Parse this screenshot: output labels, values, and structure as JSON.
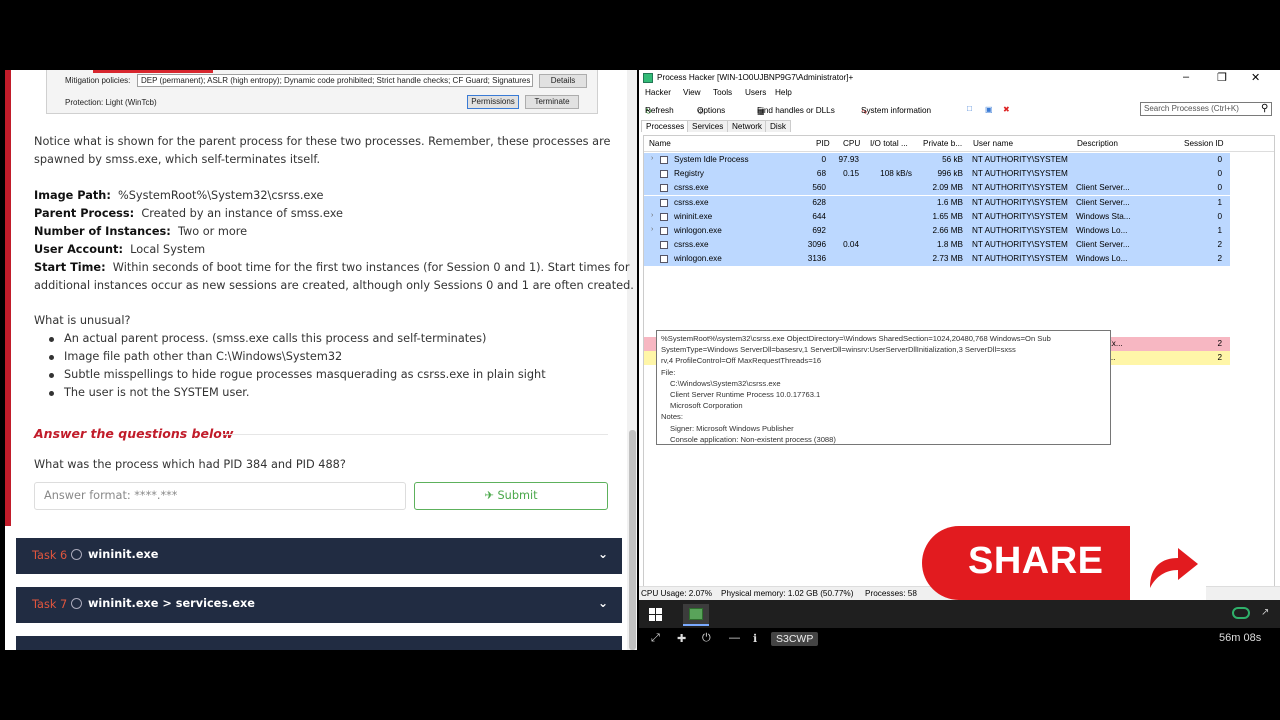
{
  "mini_screenshot": {
    "mitigation_label": "Mitigation policies:",
    "mitigation_value": "DEP (permanent); ASLR (high entropy); Dynamic code prohibited; Strict handle checks; CF Guard; Signatures re",
    "details_btn": "Details",
    "protection_label": "Protection:",
    "protection_value": "Light (WinTcb)",
    "permissions_btn": "Permissions",
    "terminate_btn": "Terminate"
  },
  "room": {
    "intro_line1": "Notice what is shown for the parent process for these two processes. Remember, these processes are",
    "intro_line2": "spawned by smss.exe, which self-terminates itself.",
    "image_path_label": "Image Path:",
    "image_path_value": "%SystemRoot%\\System32\\csrss.exe",
    "parent_label": "Parent Process:",
    "parent_value": "Created by an instance of smss.exe",
    "instances_label": "Number of Instances:",
    "instances_value": "Two or more",
    "account_label": "User Account:",
    "account_value": "Local System",
    "start_label": "Start Time:",
    "start_value1": "Within seconds of boot time for the first two instances (for Session 0 and 1). Start times for",
    "start_value2": "additional instances occur as new sessions are created, although only Sessions 0 and 1 are often created.",
    "unusual_title": "What is unusual?",
    "unusual_items": [
      "An actual parent process. (smss.exe calls this process and self-terminates)",
      "Image file path other than C:\\Windows\\System32",
      "Subtle misspellings to hide rogue processes masquerading as csrss.exe in plain sight",
      "The user is not the SYSTEM user."
    ],
    "answer_title": "Answer the questions below",
    "question": "What was the process which had PID 384 and PID 488?",
    "answer_placeholder": "Answer format: ****.***",
    "submit_label": "Submit"
  },
  "tasks": [
    {
      "num": "Task 6",
      "name": "wininit.exe"
    },
    {
      "num": "Task 7",
      "name": "wininit.exe > services.exe"
    }
  ],
  "process_hacker": {
    "title": "Process Hacker [WIN-1O0UJBNP9G7\\Administrator]+",
    "menu": [
      "Hacker",
      "View",
      "Tools",
      "Users",
      "Help"
    ],
    "toolbar": {
      "refresh": "Refresh",
      "options": "Options",
      "find": "Find handles or DLLs",
      "sysinfo": "System information"
    },
    "search_placeholder": "Search Processes (Ctrl+K)",
    "tabs": [
      "Processes",
      "Services",
      "Network",
      "Disk"
    ],
    "columns": [
      "Name",
      "PID",
      "CPU",
      "I/O total ...",
      "Private b...",
      "User name",
      "Description",
      "Session ID"
    ],
    "rows": [
      {
        "name": "System Idle Process",
        "pid": "0",
        "cpu": "97.93",
        "io": "",
        "priv": "56 kB",
        "user": "NT AUTHORITY\\SYSTEM",
        "desc": "",
        "session": "0"
      },
      {
        "name": "Registry",
        "pid": "68",
        "cpu": "0.15",
        "io": "108 kB/s",
        "priv": "996 kB",
        "user": "NT AUTHORITY\\SYSTEM",
        "desc": "",
        "session": "0"
      },
      {
        "name": "csrss.exe",
        "pid": "560",
        "cpu": "",
        "io": "",
        "priv": "2.09 MB",
        "user": "NT AUTHORITY\\SYSTEM",
        "desc": "Client Server...",
        "session": "0"
      },
      {
        "name": "csrss.exe",
        "pid": "628",
        "cpu": "",
        "io": "",
        "priv": "1.6 MB",
        "user": "NT AUTHORITY\\SYSTEM",
        "desc": "Client Server...",
        "session": "1"
      },
      {
        "name": "wininit.exe",
        "pid": "644",
        "cpu": "",
        "io": "",
        "priv": "1.65 MB",
        "user": "NT AUTHORITY\\SYSTEM",
        "desc": "Windows Sta...",
        "session": "0"
      },
      {
        "name": "winlogon.exe",
        "pid": "692",
        "cpu": "",
        "io": "",
        "priv": "2.66 MB",
        "user": "NT AUTHORITY\\SYSTEM",
        "desc": "Windows Lo...",
        "session": "1"
      },
      {
        "name": "csrss.exe",
        "pid": "3096",
        "cpu": "0.04",
        "io": "",
        "priv": "1.8 MB",
        "user": "NT AUTHORITY\\SYSTEM",
        "desc": "Client Server...",
        "session": "2"
      },
      {
        "name": "winlogon.exe",
        "pid": "3136",
        "cpu": "",
        "io": "",
        "priv": "2.73 MB",
        "user": "NT AUTHORITY\\SYSTEM",
        "desc": "Windows Lo...",
        "session": "2"
      }
    ],
    "partial_rows": [
      {
        "desc": "ws Ex...",
        "session": "2"
      },
      {
        "desc": "Hac...",
        "session": "2"
      }
    ],
    "tooltip": [
      "%SystemRoot%\\system32\\csrss.exe ObjectDirectory=\\Windows SharedSection=1024,20480,768 Windows=On Sub",
      "SystemType=Windows ServerDll=basesrv,1 ServerDll=winsrv:UserServerDllInitialization,3 ServerDll=sxss",
      "rv,4 ProfileControl=Off MaxRequestThreads=16",
      "File:",
      "C:\\Windows\\System32\\csrss.exe",
      "Client Server Runtime Process 10.0.17763.1",
      "Microsoft Corporation",
      "Notes:",
      "Signer: Microsoft Windows Publisher",
      "Console application: Non-existent process (3088)"
    ],
    "status": {
      "cpu": "CPU Usage: 2.07%",
      "mem": "Physical memory: 1.02 GB (50.77%)",
      "procs": "Processes: 58"
    }
  },
  "guac": {
    "tag": "S3CWP",
    "timer": "56m 08s"
  },
  "share": {
    "label": "SHARE"
  },
  "colors": {
    "accent_red": "#c11c2a",
    "task_bg": "#212c42",
    "row_highlight": "#bcd8ff",
    "submit_green": "#4aa84a",
    "share_red": "#e21b1f"
  }
}
